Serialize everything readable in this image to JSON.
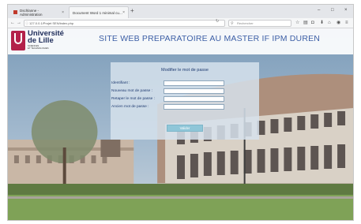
{
  "browser": {
    "tabs": [
      {
        "label": "Dschlanne - Administration",
        "active": false
      },
      {
        "label": "Document Word 1 minimal cu...",
        "active": true
      }
    ],
    "new_tab_glyph": "+",
    "window_controls": [
      "–",
      "□",
      "×"
    ],
    "url": "127.0.0.1/Projet SEN/index.php",
    "search_placeholder": "Rechercher",
    "toolbar_icons": [
      "star-icon",
      "reading-list-icon",
      "pocket-icon",
      "download-icon",
      "home-icon",
      "extension-icon",
      "menu-icon"
    ]
  },
  "site": {
    "logo_line1": "Université",
    "logo_line2": "de Lille",
    "logo_sub1": "SCIENCES",
    "logo_sub2": "ET TECHNOLOGIES",
    "title": "SITE WEB PREPARATOIRE AU MASTER IF IPM DUREN"
  },
  "form": {
    "title": "Modifier le mot de passe",
    "fields": [
      {
        "label": "Identifiant :",
        "value": ""
      },
      {
        "label": "Nouveau mot de passe :",
        "value": ""
      },
      {
        "label": "Retaper le mot de passe :",
        "value": ""
      },
      {
        "label": "Ancien mot de passe :",
        "value": ""
      }
    ],
    "submit_label": "Valider"
  },
  "colors": {
    "brand_red": "#b3214a",
    "title_blue": "#3d5fa6",
    "button_cyan": "#8fc6d8"
  }
}
